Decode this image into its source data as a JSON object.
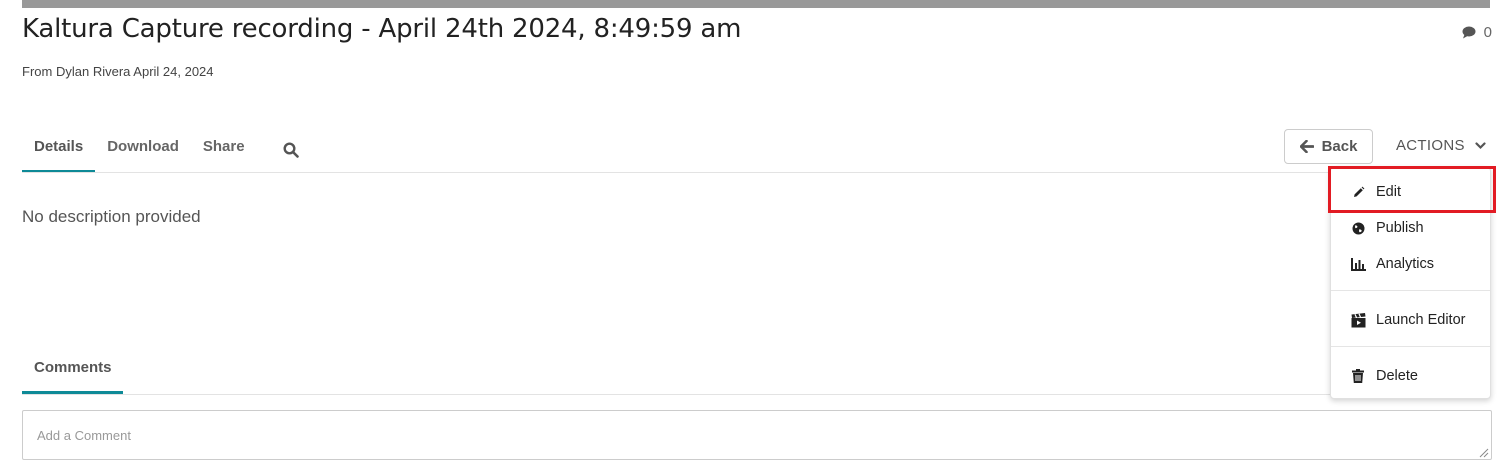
{
  "media": {
    "title": "Kaltura Capture recording - April 24th 2024, 8:49:59 am",
    "comment_count": "0",
    "byline_prefix": "From",
    "author": "Dylan Rivera",
    "date": "April 24, 2024"
  },
  "tabs": [
    {
      "label": "Details",
      "active": true
    },
    {
      "label": "Download",
      "active": false
    },
    {
      "label": "Share",
      "active": false
    }
  ],
  "toolbar": {
    "back_label": "Back",
    "actions_label": "ACTIONS"
  },
  "details": {
    "description": "No description provided"
  },
  "comments": {
    "tab_label": "Comments",
    "input_placeholder": "Add a Comment"
  },
  "actions_menu": {
    "items": [
      {
        "label": "Edit",
        "icon": "pencil-icon",
        "highlighted": true
      },
      {
        "label": "Publish",
        "icon": "globe-icon"
      },
      {
        "label": "Analytics",
        "icon": "bar-chart-icon"
      },
      {
        "label": "Launch Editor",
        "icon": "clapperboard-icon"
      },
      {
        "label": "Delete",
        "icon": "trash-icon"
      }
    ]
  },
  "colors": {
    "accent": "#0e8a97",
    "highlight": "#e21b23"
  }
}
